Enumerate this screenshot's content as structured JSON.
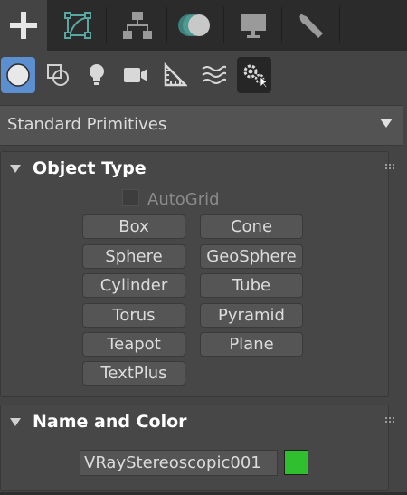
{
  "command_panel": {
    "tabs": [
      {
        "name": "create",
        "icon": "plus-icon",
        "active": true
      },
      {
        "name": "modify",
        "icon": "modify-icon",
        "active": false
      },
      {
        "name": "hierarchy",
        "icon": "hierarchy-icon",
        "active": false
      },
      {
        "name": "motion",
        "icon": "motion-icon",
        "active": false
      },
      {
        "name": "display",
        "icon": "monitor-icon",
        "active": false
      },
      {
        "name": "utilities",
        "icon": "wrench-icon",
        "active": false
      }
    ],
    "create_categories": [
      {
        "name": "geometry",
        "icon": "sphere-icon",
        "active": true
      },
      {
        "name": "shapes",
        "icon": "shapes-icon",
        "active": false
      },
      {
        "name": "lights",
        "icon": "lightbulb-icon",
        "active": false
      },
      {
        "name": "cameras",
        "icon": "camera-icon",
        "active": false
      },
      {
        "name": "helpers",
        "icon": "helper-ruler-icon",
        "active": false
      },
      {
        "name": "space-warps",
        "icon": "wave-icon",
        "active": false
      },
      {
        "name": "systems",
        "icon": "gears-icon",
        "active": false,
        "hover": true
      }
    ]
  },
  "dropdown": {
    "selected": "Standard Primitives"
  },
  "object_type": {
    "title": "Object Type",
    "autogrid_label": "AutoGrid",
    "autogrid_checked": false,
    "buttons": [
      "Box",
      "Cone",
      "Sphere",
      "GeoSphere",
      "Cylinder",
      "Tube",
      "Torus",
      "Pyramid",
      "Teapot",
      "Plane",
      "TextPlus"
    ]
  },
  "name_and_color": {
    "title": "Name and Color",
    "name_value": "VRayStereoscopic001",
    "color": "#2fbf2f"
  },
  "colors": {
    "accent": "#5b8fd0",
    "icon_teal": "#5aa6a0"
  }
}
